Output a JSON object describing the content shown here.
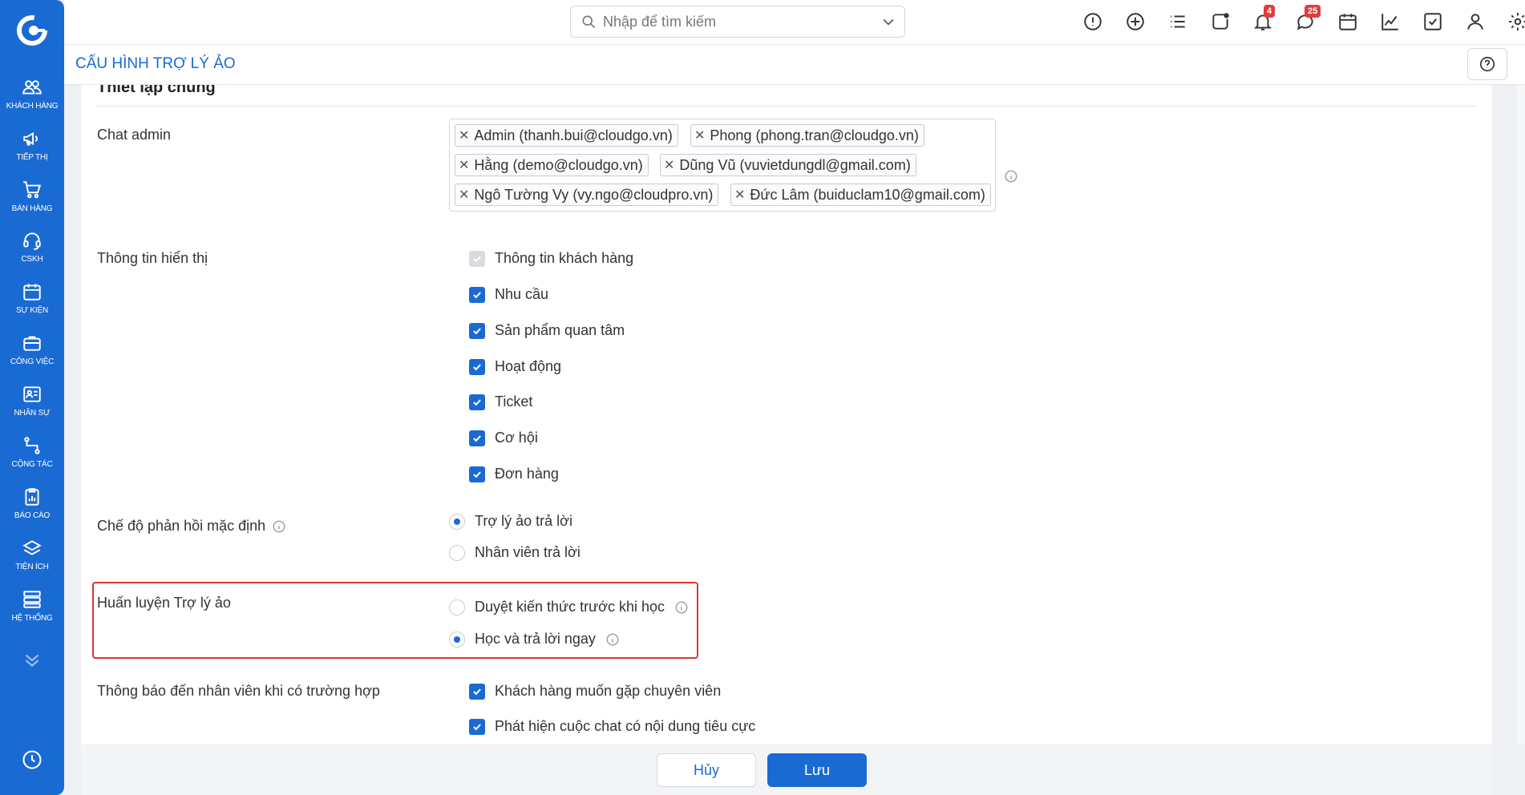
{
  "sidebar": {
    "items": [
      {
        "label": "KHÁCH HÀNG",
        "icon": "users-icon"
      },
      {
        "label": "TIẾP THỊ",
        "icon": "megaphone-icon"
      },
      {
        "label": "BÁN HÀNG",
        "icon": "cart-icon"
      },
      {
        "label": "CSKH",
        "icon": "headset-icon"
      },
      {
        "label": "SỰ KIỆN",
        "icon": "calendar-icon"
      },
      {
        "label": "CÔNG VIỆC",
        "icon": "briefcase-icon"
      },
      {
        "label": "NHÂN SỰ",
        "icon": "id-card-icon"
      },
      {
        "label": "CỘNG TÁC",
        "icon": "collaborate-icon"
      },
      {
        "label": "BÁO CÁO",
        "icon": "report-icon"
      },
      {
        "label": "TIỆN ÍCH",
        "icon": "layers-icon"
      },
      {
        "label": "HỆ THỐNG",
        "icon": "server-icon"
      }
    ]
  },
  "topbar": {
    "search_placeholder": "Nhập để tìm kiếm",
    "notification_count": "4",
    "message_count": "25"
  },
  "page": {
    "title": "CẤU HÌNH TRỢ LÝ ẢO",
    "section_title": "Thiết lập chung"
  },
  "form": {
    "chat_admin": {
      "label": "Chat admin",
      "tags": [
        "Admin (thanh.bui@cloudgo.vn)",
        "Phong (phong.tran@cloudgo.vn)",
        "Hằng (demo@cloudgo.vn)",
        "Dũng Vũ (vuvietdungdl@gmail.com)",
        "Ngô Tường Vy (vy.ngo@cloudpro.vn)",
        "Đức Lâm (buiduclam10@gmail.com)"
      ]
    },
    "display_info": {
      "label": "Thông tin hiển thị",
      "options": [
        {
          "label": "Thông tin khách hàng",
          "checked": true,
          "disabled": true
        },
        {
          "label": "Nhu cầu",
          "checked": true
        },
        {
          "label": "Sản phẩm quan tâm",
          "checked": true
        },
        {
          "label": "Hoạt động",
          "checked": true
        },
        {
          "label": "Ticket",
          "checked": true
        },
        {
          "label": "Cơ hội",
          "checked": true
        },
        {
          "label": "Đơn hàng",
          "checked": true
        }
      ]
    },
    "response_mode": {
      "label": "Chế độ phản hồi mặc định",
      "options": [
        {
          "label": "Trợ lý ảo trả lời",
          "selected": true
        },
        {
          "label": "Nhân viên trả lời",
          "selected": false
        }
      ]
    },
    "training": {
      "label": "Huấn luyện Trợ lý ảo",
      "options": [
        {
          "label": "Duyệt kiến thức trước khi học",
          "selected": false
        },
        {
          "label": "Học và trả lời ngay",
          "selected": true
        }
      ]
    },
    "notify": {
      "label": "Thông báo đến nhân viên khi có trường hợp",
      "options": [
        {
          "label": "Khách hàng muốn gặp chuyên viên",
          "checked": true
        },
        {
          "label": "Phát hiện cuộc chat có nội dung tiêu cực",
          "checked": true
        }
      ]
    }
  },
  "footer": {
    "cancel_label": "Hủy",
    "save_label": "Lưu"
  },
  "colors": {
    "primary": "#1a6ad3",
    "highlight_border": "#e03333"
  }
}
